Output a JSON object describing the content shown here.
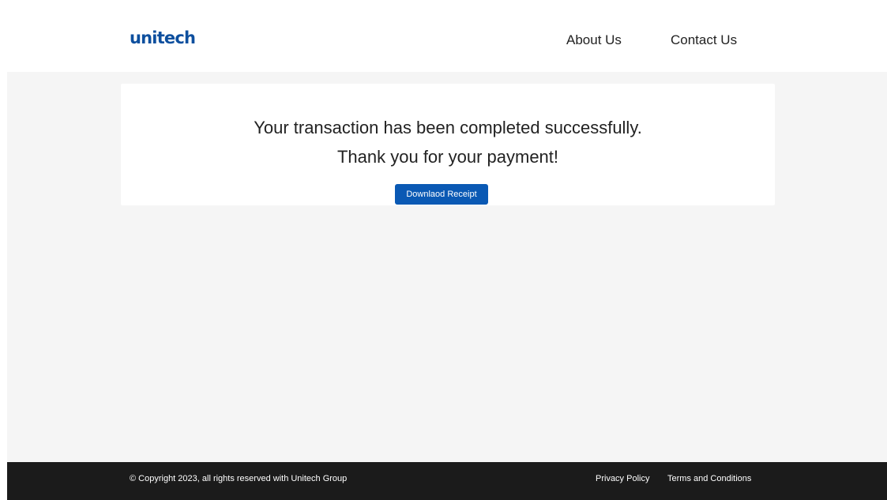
{
  "header": {
    "logo_text": "unitech",
    "nav": {
      "about": "About Us",
      "contact": "Contact Us"
    }
  },
  "main": {
    "message_line1": "Your transaction has been completed successfully.",
    "message_line2": "Thank you for your payment!",
    "download_button_label": "Downlaod Receipt"
  },
  "footer": {
    "copyright": "© Copyright 2023, all rights reserved with Unitech Group",
    "links": {
      "privacy": "Privacy Policy",
      "terms": "Terms and Conditions"
    }
  },
  "colors": {
    "brand_blue": "#0d4f9e",
    "button_blue": "#0a59b4",
    "footer_bg": "#1b1b1b",
    "page_bg": "#f5f5f5"
  }
}
